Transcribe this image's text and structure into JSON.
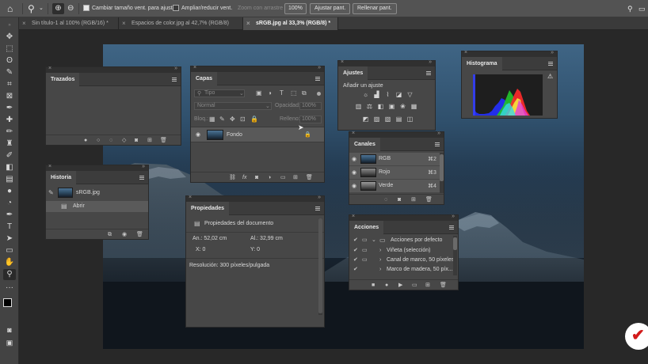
{
  "colors": {
    "background": "#282828",
    "panel": "#474747",
    "options_bar": "#535353"
  },
  "options_bar": {
    "home_icon": "home-icon",
    "zoom_icon": "zoom-icon",
    "resize_windows": "Cambiar tamaño vent. para ajustar",
    "zoom_all": "Ampliar/reducir vent.",
    "scrubby_zoom": "Zoom con arrastre",
    "zoom_percent": "100%",
    "fit_screen": "Ajustar pant.",
    "fill_screen": "Rellenar pant."
  },
  "tabs": [
    {
      "label": "Sin título-1 al 100% (RGB/16) *"
    },
    {
      "label": "Espacios de color.jpg al 42,7% (RGB/8)"
    },
    {
      "label": "sRGB.jpg al 33,3% (RGB/8) *"
    }
  ],
  "trazados": {
    "title": "Trazados"
  },
  "historia": {
    "title": "Historia",
    "snapshot": "sRGB.jpg",
    "step": "Abrir"
  },
  "capas": {
    "title": "Capas",
    "filter_type": "Tipo",
    "blend_mode": "Normal",
    "opacity_label": "Opacidad:",
    "opacity_value": "100%",
    "lock_label": "Bloq.:",
    "fill_label": "Relleno:",
    "fill_value": "100%",
    "layer": "Fondo"
  },
  "propiedades": {
    "title": "Propiedades",
    "subtitle": "Propiedades del documento",
    "an": "An.: 52,02 cm",
    "al": "Al.: 32,99 cm",
    "x": "X: 0",
    "y": "Y: 0",
    "resolution": "Resolución: 300 píxeles/pulgada"
  },
  "ajustes": {
    "title": "Ajustes",
    "subtitle": "Añadir un ajuste"
  },
  "canales": {
    "title": "Canales",
    "channels": [
      {
        "name": "RGB",
        "shortcut": "⌘2"
      },
      {
        "name": "Rojo",
        "shortcut": "⌘3"
      },
      {
        "name": "Verde",
        "shortcut": "⌘4"
      }
    ]
  },
  "histograma": {
    "title": "Histograma"
  },
  "acciones": {
    "title": "Acciones",
    "items": [
      {
        "label": "Acciones por defecto"
      },
      {
        "label": "Viñeta (selección)"
      },
      {
        "label": "Canal de marco, 50 píxeles"
      },
      {
        "label": "Marco de madera, 50 píx..."
      }
    ]
  }
}
